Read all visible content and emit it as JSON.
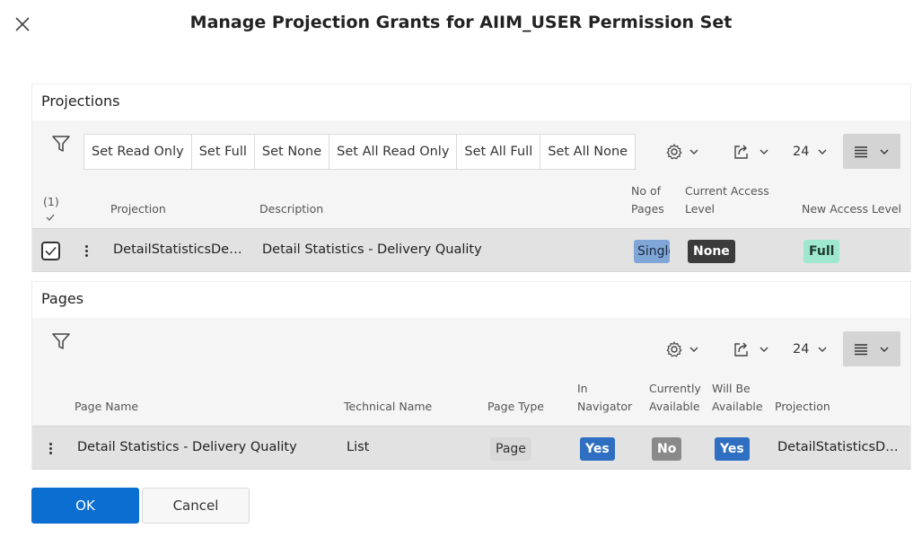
{
  "dialog": {
    "title": "Manage Projection Grants for AIIM_USER Permission Set",
    "ok_label": "OK",
    "cancel_label": "Cancel"
  },
  "colors": {
    "accent": "#0b6ed1",
    "badge_yes": "#2f6fc2",
    "badge_no": "#8a8a8a",
    "badge_none": "#3b3b3b",
    "badge_full": "#9fe8cf",
    "badge_single": "#7fa6d6",
    "row_selected": "#e2e2e2"
  },
  "projections": {
    "title": "Projections",
    "actions": [
      "Set Read Only",
      "Set Full",
      "Set None",
      "Set All Read Only",
      "Set All Full",
      "Set All None"
    ],
    "page_size": "24",
    "selection_count": "(1)",
    "columns": {
      "projection": "Projection",
      "description": "Description",
      "no_of_pages_1": "No of",
      "no_of_pages_2": "Pages",
      "current_access_1": "Current Access",
      "current_access_2": "Level",
      "new_access": "New Access Level"
    },
    "rows": [
      {
        "projection": "DetailStatisticsDeliveryQuality",
        "description": "Detail Statistics - Delivery Quality",
        "no_of_pages": "Single",
        "current_access": "None",
        "new_access": "Full"
      }
    ]
  },
  "pages": {
    "title": "Pages",
    "page_size": "24",
    "columns": {
      "page_name": "Page Name",
      "technical_name": "Technical Name",
      "page_type": "Page Type",
      "in_navigator_1": "In",
      "in_navigator_2": "Navigator",
      "currently_available_1": "Currently",
      "currently_available_2": "Available",
      "will_be_available_1": "Will Be",
      "will_be_available_2": "Available",
      "projection": "Projection"
    },
    "rows": [
      {
        "page_name": "Detail Statistics - Delivery Quality",
        "technical_name": "List",
        "page_type": "Page",
        "in_navigator": "Yes",
        "currently_available": "No",
        "will_be_available": "Yes",
        "projection": "DetailStatisticsDeliveryQuality"
      }
    ]
  },
  "icons": [
    "close-icon",
    "filter-icon",
    "gear-icon",
    "export-icon",
    "chevron-down-icon",
    "list-view-icon",
    "checkmark-icon",
    "kebab-menu-icon"
  ]
}
